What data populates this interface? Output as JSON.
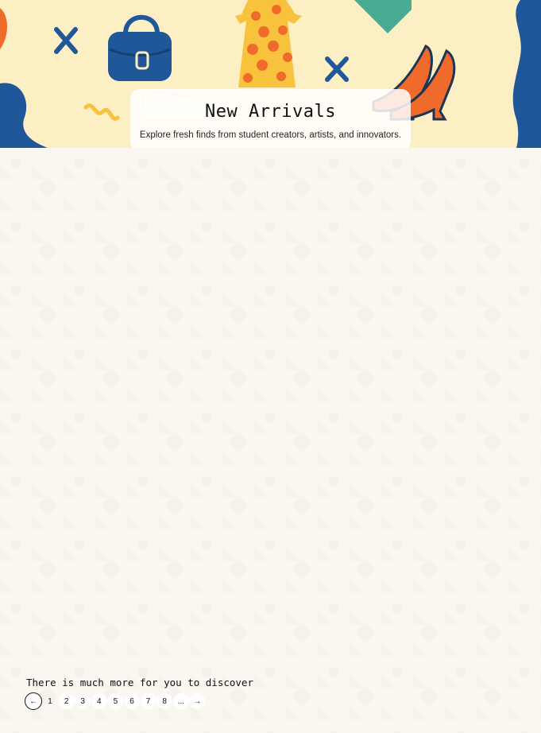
{
  "hero": {
    "title": "New Arrivals",
    "subtitle": "Explore fresh finds from student creators, artists, and innovators.",
    "colors": {
      "background": "#fdefc4",
      "blue": "#1f5799",
      "orange": "#f06b2b",
      "yellow": "#f9c23c",
      "teal": "#4aab95"
    }
  },
  "footer": {
    "discover_text": "There is much more for you to discover"
  },
  "pagination": {
    "prev_icon": "arrow-left-icon",
    "next_icon": "arrow-right-icon",
    "prev_symbol": "←",
    "next_symbol": "→",
    "pages": [
      "1",
      "2",
      "3",
      "4",
      "5",
      "6",
      "7",
      "8"
    ],
    "ellipsis": "..."
  }
}
